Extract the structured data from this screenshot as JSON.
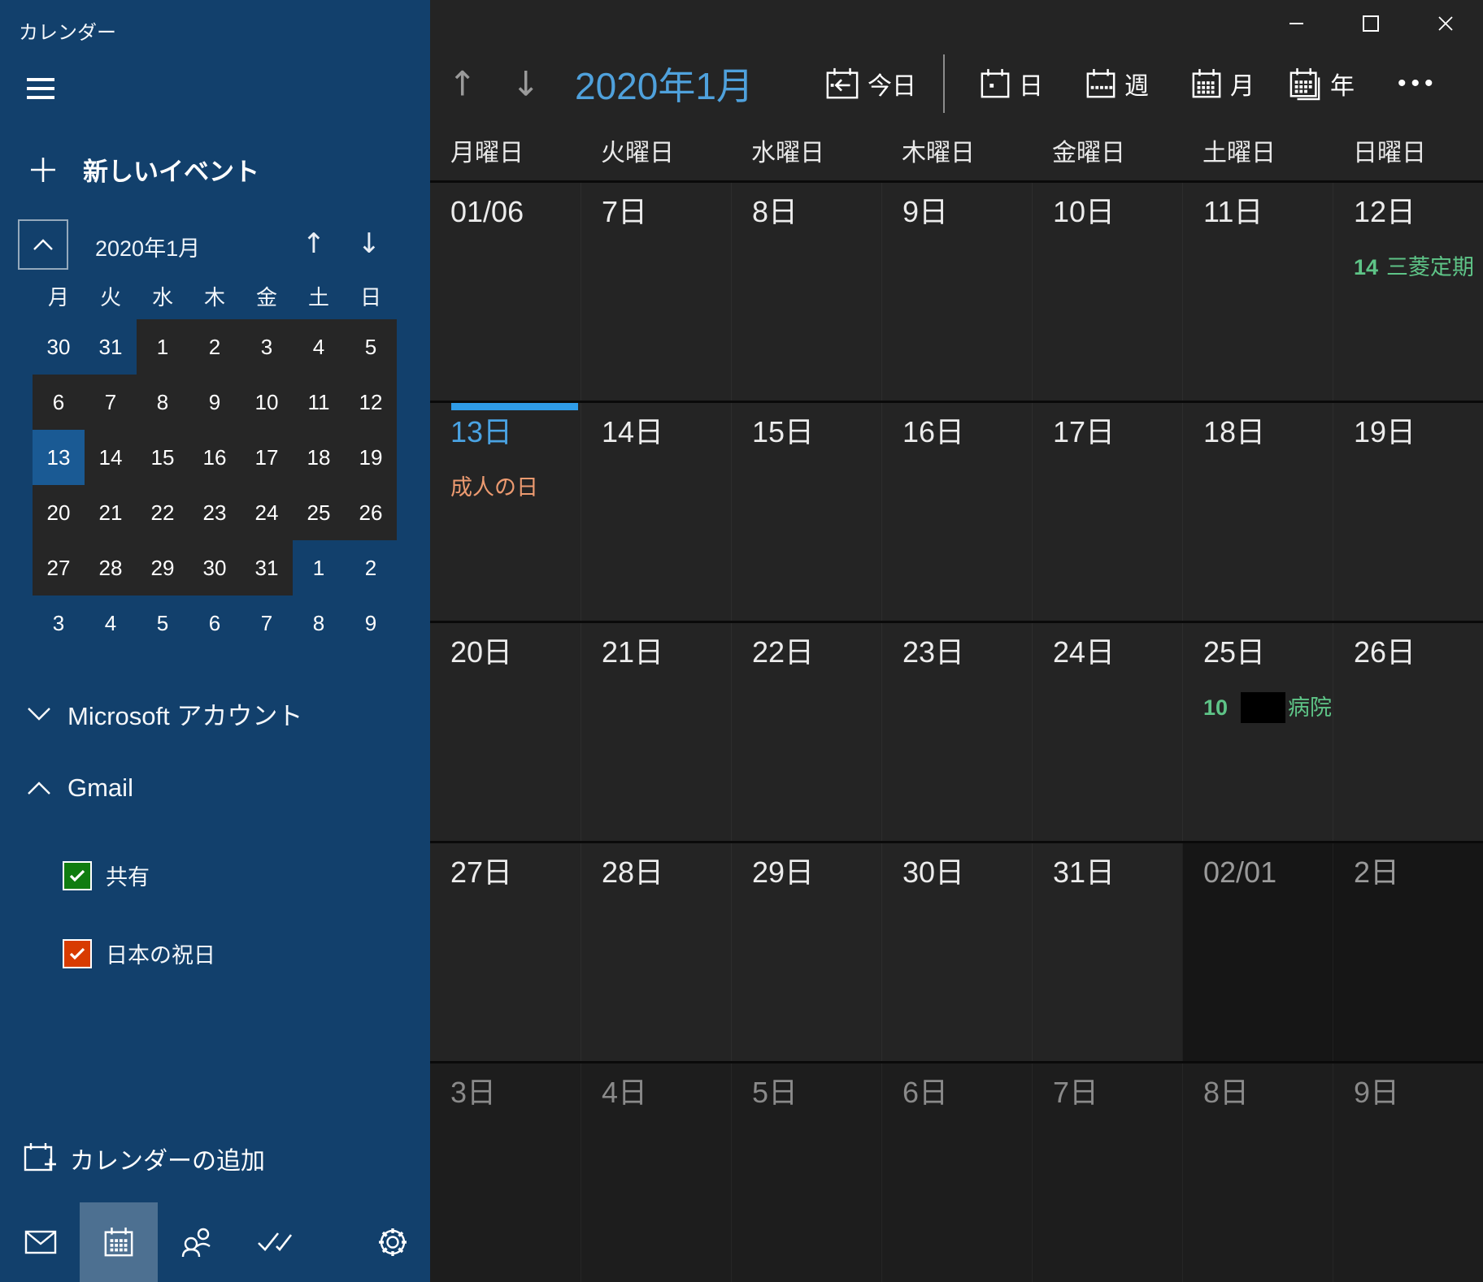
{
  "app": {
    "title": "カレンダー"
  },
  "window_controls": {
    "minimize": "minimize",
    "maximize": "maximize",
    "close": "close"
  },
  "colors": {
    "accent_blue": "#4fa1dc",
    "selection_bar": "#2f9ce8",
    "event_green": "#5ec487",
    "holiday_orange": "#ec9a70",
    "checkbox_green": "#107C10",
    "checkbox_red": "#D83B01"
  },
  "sidebar": {
    "new_event_label": "新しいイベント",
    "mini_calendar": {
      "title": "2020年1月",
      "weekdays": [
        "月",
        "火",
        "水",
        "木",
        "金",
        "土",
        "日"
      ],
      "selected_day": "13",
      "weeks": [
        [
          {
            "d": "30",
            "out": true
          },
          {
            "d": "31",
            "out": true
          },
          {
            "d": "1"
          },
          {
            "d": "2"
          },
          {
            "d": "3"
          },
          {
            "d": "4"
          },
          {
            "d": "5"
          }
        ],
        [
          {
            "d": "6"
          },
          {
            "d": "7"
          },
          {
            "d": "8"
          },
          {
            "d": "9"
          },
          {
            "d": "10"
          },
          {
            "d": "11"
          },
          {
            "d": "12"
          }
        ],
        [
          {
            "d": "13",
            "selected": true
          },
          {
            "d": "14"
          },
          {
            "d": "15"
          },
          {
            "d": "16"
          },
          {
            "d": "17"
          },
          {
            "d": "18"
          },
          {
            "d": "19"
          }
        ],
        [
          {
            "d": "20"
          },
          {
            "d": "21"
          },
          {
            "d": "22"
          },
          {
            "d": "23"
          },
          {
            "d": "24"
          },
          {
            "d": "25"
          },
          {
            "d": "26"
          }
        ],
        [
          {
            "d": "27"
          },
          {
            "d": "28"
          },
          {
            "d": "29"
          },
          {
            "d": "30"
          },
          {
            "d": "31"
          },
          {
            "d": "1",
            "out": true
          },
          {
            "d": "2",
            "out": true
          }
        ],
        [
          {
            "d": "3",
            "out": true
          },
          {
            "d": "4",
            "out": true
          },
          {
            "d": "5",
            "out": true
          },
          {
            "d": "6",
            "out": true
          },
          {
            "d": "7",
            "out": true
          },
          {
            "d": "8",
            "out": true
          },
          {
            "d": "9",
            "out": true
          }
        ]
      ]
    },
    "accounts": [
      {
        "label": "Microsoft アカウント",
        "state": "collapsed"
      },
      {
        "label": "Gmail",
        "state": "expanded"
      }
    ],
    "calendars": [
      {
        "label": "共有",
        "checked": true,
        "color": "#107C10"
      },
      {
        "label": "日本の祝日",
        "checked": true,
        "color": "#D83B01"
      }
    ],
    "add_calendar_label": "カレンダーの追加",
    "nav": [
      {
        "icon": "mail",
        "active": false
      },
      {
        "icon": "calendar",
        "active": true
      },
      {
        "icon": "people",
        "active": false
      },
      {
        "icon": "tasks",
        "active": false
      },
      {
        "icon": "settings",
        "active": false
      }
    ]
  },
  "toolbar": {
    "title": "2020年1月",
    "today_label": "今日",
    "views": [
      {
        "id": "day",
        "label": "日"
      },
      {
        "id": "week",
        "label": "週"
      },
      {
        "id": "month",
        "label": "月"
      },
      {
        "id": "year",
        "label": "年"
      }
    ],
    "more_label": "•••"
  },
  "calendar_grid": {
    "weekday_headers": [
      "月曜日",
      "火曜日",
      "水曜日",
      "木曜日",
      "金曜日",
      "土曜日",
      "日曜日"
    ],
    "weeks": [
      {
        "days": [
          {
            "label": "01/06"
          },
          {
            "label": "7日"
          },
          {
            "label": "8日"
          },
          {
            "label": "9日"
          },
          {
            "label": "10日"
          },
          {
            "label": "11日"
          },
          {
            "label": "12日",
            "events": [
              {
                "time": "14",
                "title": "三菱定期",
                "kind": "personal"
              }
            ]
          }
        ]
      },
      {
        "days": [
          {
            "label": "13日",
            "selected": true,
            "events": [
              {
                "title": "成人の日",
                "kind": "holiday"
              }
            ]
          },
          {
            "label": "14日"
          },
          {
            "label": "15日"
          },
          {
            "label": "16日"
          },
          {
            "label": "17日"
          },
          {
            "label": "18日"
          },
          {
            "label": "19日"
          }
        ]
      },
      {
        "days": [
          {
            "label": "20日"
          },
          {
            "label": "21日"
          },
          {
            "label": "22日"
          },
          {
            "label": "23日"
          },
          {
            "label": "24日"
          },
          {
            "label": "25日",
            "events": [
              {
                "time": "10",
                "title": "病院",
                "redacted": true,
                "kind": "personal"
              }
            ]
          },
          {
            "label": "26日"
          }
        ]
      },
      {
        "days": [
          {
            "label": "27日"
          },
          {
            "label": "28日"
          },
          {
            "label": "29日"
          },
          {
            "label": "30日"
          },
          {
            "label": "31日"
          },
          {
            "label": "02/01",
            "other": "dark"
          },
          {
            "label": "2日",
            "other": "dark"
          }
        ]
      },
      {
        "days": [
          {
            "label": "3日",
            "other": "dim"
          },
          {
            "label": "4日",
            "other": "dim"
          },
          {
            "label": "5日",
            "other": "dim"
          },
          {
            "label": "6日",
            "other": "dim"
          },
          {
            "label": "7日",
            "other": "dim"
          },
          {
            "label": "8日",
            "other": "dim"
          },
          {
            "label": "9日",
            "other": "dim"
          }
        ]
      }
    ]
  }
}
